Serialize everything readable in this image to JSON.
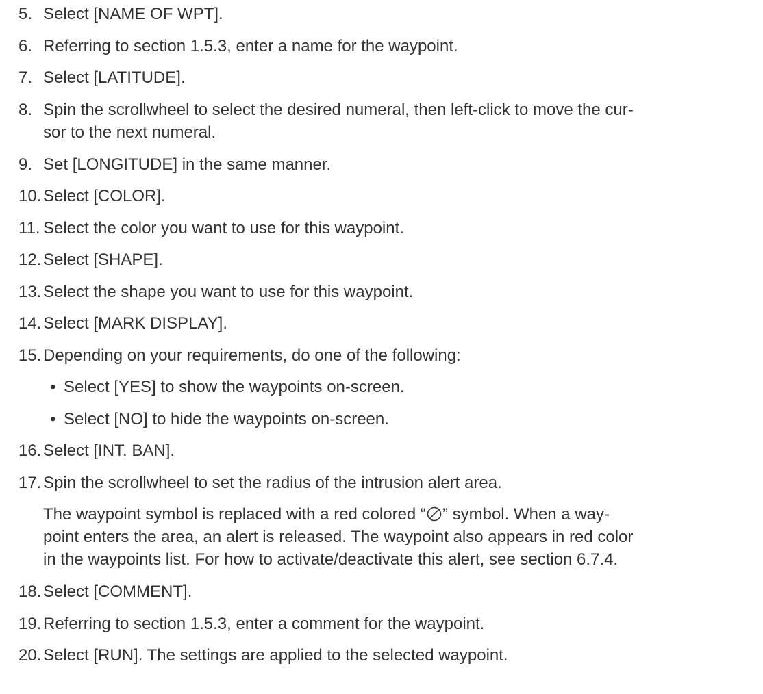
{
  "steps": [
    {
      "num": "5.",
      "lines": [
        "Select [NAME OF WPT]."
      ]
    },
    {
      "num": "6.",
      "lines": [
        "Referring to section 1.5.3, enter a name for the waypoint."
      ]
    },
    {
      "num": "7.",
      "lines": [
        "Select [LATITUDE]."
      ]
    },
    {
      "num": "8.",
      "lines": [
        "Spin the scrollwheel to select the desired numeral, then left-click to move the cur-",
        "sor to the next numeral."
      ]
    },
    {
      "num": "9.",
      "lines": [
        "Set [LONGITUDE] in the same manner."
      ]
    },
    {
      "num": "10.",
      "lines": [
        "Select [COLOR]."
      ]
    },
    {
      "num": "11.",
      "lines": [
        "Select the color you want to use for this waypoint."
      ]
    },
    {
      "num": "12.",
      "lines": [
        "Select [SHAPE]."
      ]
    },
    {
      "num": "13.",
      "lines": [
        "Select the shape you want to use for this waypoint."
      ]
    },
    {
      "num": "14.",
      "lines": [
        "Select [MARK DISPLAY]."
      ]
    },
    {
      "num": "15.",
      "lines": [
        "Depending on your requirements, do one of the following:"
      ]
    },
    {
      "num": "16.",
      "lines": [
        "Select [INT. BAN]."
      ]
    },
    {
      "num": "17.",
      "lines": [
        "Spin the scrollwheel to set the radius of the intrusion alert area."
      ]
    },
    {
      "num": "18.",
      "lines": [
        "Select [COMMENT]."
      ]
    },
    {
      "num": "19.",
      "lines": [
        "Referring to section 1.5.3, enter a comment for the waypoint."
      ]
    },
    {
      "num": "20.",
      "lines": [
        "Select [RUN]. The settings are applied to the selected waypoint."
      ]
    }
  ],
  "bullets": [
    "Select [YES] to show the waypoints on-screen.",
    "Select [NO] to hide the waypoints on-screen."
  ],
  "bullet_glyph": "•",
  "note": {
    "line1_before": "The waypoint symbol is replaced with a red colored “",
    "symbol": "no-entry-icon",
    "line1_after": "” symbol. When a way-",
    "line2": "point enters the area, an alert is released. The waypoint also appears in red color",
    "line3": "in the waypoints list. For how to activate/deactivate this alert, see section 6.7.4."
  }
}
